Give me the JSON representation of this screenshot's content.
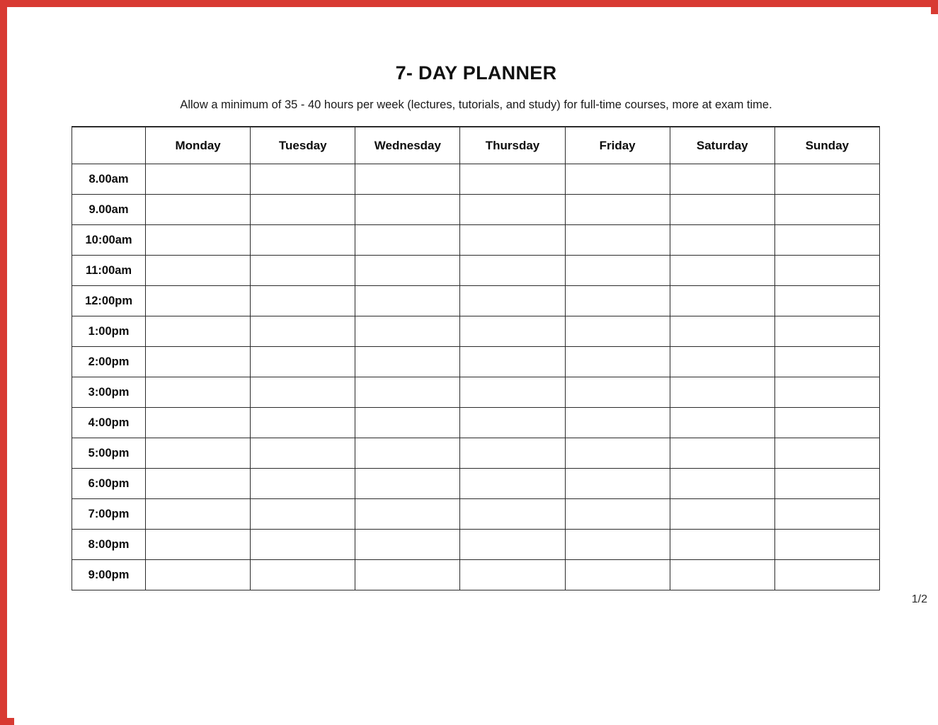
{
  "page": {
    "title": "7- DAY PLANNER",
    "subtitle": "Allow a minimum of 35 - 40 hours per week (lectures, tutorials, and study) for full-time courses, more at exam time.",
    "page_indicator": "1/2",
    "border_color": "#d83a32",
    "grid_color": "#2b2b2b",
    "background_color": "#ffffff"
  },
  "planner": {
    "corner_header": "",
    "day_headers": [
      "Monday",
      "Tuesday",
      "Wednesday",
      "Thursday",
      "Friday",
      "Saturday",
      "Sunday"
    ],
    "time_slots": [
      "8.00am",
      "9.00am",
      "10:00am",
      "11:00am",
      "12:00pm",
      "1:00pm",
      "2:00pm",
      "3:00pm",
      "4:00pm",
      "5:00pm",
      "6:00pm",
      "7:00pm",
      "8:00pm",
      "9:00pm"
    ],
    "entries": [
      [
        "",
        "",
        "",
        "",
        "",
        "",
        ""
      ],
      [
        "",
        "",
        "",
        "",
        "",
        "",
        ""
      ],
      [
        "",
        "",
        "",
        "",
        "",
        "",
        ""
      ],
      [
        "",
        "",
        "",
        "",
        "",
        "",
        ""
      ],
      [
        "",
        "",
        "",
        "",
        "",
        "",
        ""
      ],
      [
        "",
        "",
        "",
        "",
        "",
        "",
        ""
      ],
      [
        "",
        "",
        "",
        "",
        "",
        "",
        ""
      ],
      [
        "",
        "",
        "",
        "",
        "",
        "",
        ""
      ],
      [
        "",
        "",
        "",
        "",
        "",
        "",
        ""
      ],
      [
        "",
        "",
        "",
        "",
        "",
        "",
        ""
      ],
      [
        "",
        "",
        "",
        "",
        "",
        "",
        ""
      ],
      [
        "",
        "",
        "",
        "",
        "",
        "",
        ""
      ],
      [
        "",
        "",
        "",
        "",
        "",
        "",
        ""
      ],
      [
        "",
        "",
        "",
        "",
        "",
        "",
        ""
      ]
    ]
  }
}
